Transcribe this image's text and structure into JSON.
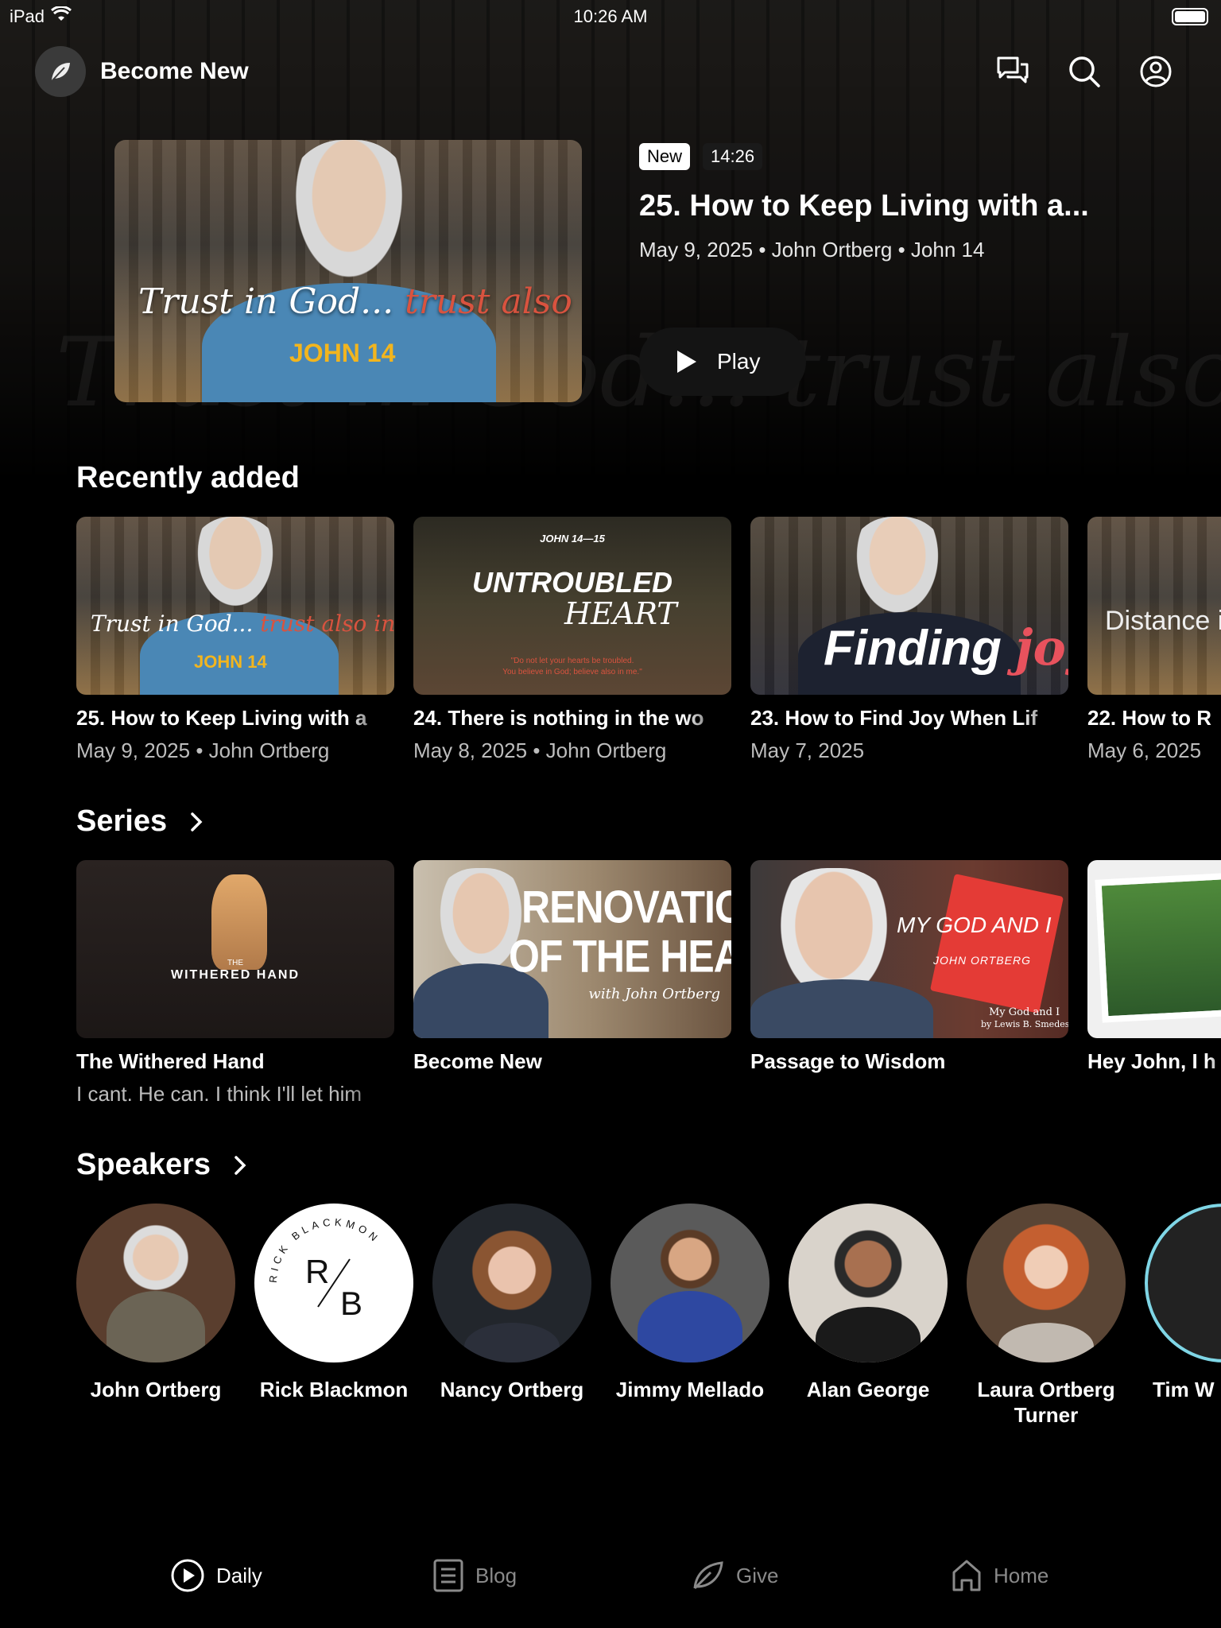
{
  "status_bar": {
    "device": "iPad",
    "time": "10:26 AM"
  },
  "header": {
    "app_title": "Become New",
    "icons": [
      "messages-icon",
      "search-icon",
      "profile-icon"
    ]
  },
  "featured": {
    "badge_new": "New",
    "duration": "14:26",
    "title": "25. How to Keep Living with a...",
    "meta": "May 9, 2025 • John Ortberg • John 14",
    "play_label": "Play",
    "thumb_line1_a": "Trust in God...",
    "thumb_line1_b": "trust also in me",
    "thumb_line2": "JOHN 14",
    "bg_text": "Trust in God... trust also in me"
  },
  "recently_added": {
    "title": "Recently added",
    "items": [
      {
        "title": "25. How to Keep Living with a",
        "meta": "May 9, 2025 • John Ortberg",
        "art_a": "Trust in God...",
        "art_b": "trust also in me",
        "art_c": "JOHN 14"
      },
      {
        "title": "24. There is nothing in the wo",
        "meta": "May 8, 2025 • John Ortberg",
        "art_a": "JOHN 14—15",
        "art_b": "UNTROUBLED",
        "art_c": "HEART",
        "art_d": "\"Do not let your hearts be troubled.",
        "art_e": "You believe in God; believe also in me.\""
      },
      {
        "title": "23. How to Find Joy When Lif",
        "meta": "May 7, 2025",
        "art_a": "Finding",
        "art_b": "joy"
      },
      {
        "title": "22. How to R",
        "meta": "May 6, 2025",
        "art_a": "Distance is"
      }
    ]
  },
  "series": {
    "title": "Series",
    "items": [
      {
        "title": "The Withered Hand",
        "subtitle": "I cant. He can. I think I'll let him",
        "art_a": "THE",
        "art_b": "WITHERED HAND"
      },
      {
        "title": "Become New",
        "subtitle": "",
        "art_a": "RENOVATION",
        "art_b": "OF THE HEART",
        "art_c": "with John Ortberg"
      },
      {
        "title": "Passage to Wisdom",
        "subtitle": "",
        "art_a": "MY GOD AND I",
        "art_b": "JOHN ORTBERG",
        "art_c": "My God and I",
        "art_d": "by Lewis B. Smedes"
      },
      {
        "title": "Hey John, I h",
        "subtitle": ""
      }
    ]
  },
  "speakers": {
    "title": "Speakers",
    "items": [
      {
        "name": "John Ortberg"
      },
      {
        "name": "Rick Blackmon",
        "logo_a": "R",
        "logo_b": "B",
        "logo_ring": "RICK BLACKMON"
      },
      {
        "name": "Nancy Ortberg"
      },
      {
        "name": "Jimmy Mellado"
      },
      {
        "name": "Alan George"
      },
      {
        "name": "Laura Ortberg Turner"
      },
      {
        "name": "Tim W"
      }
    ]
  },
  "bottom_nav": [
    {
      "label": "Daily",
      "icon": "play-circle-icon",
      "active": true
    },
    {
      "label": "Blog",
      "icon": "blog-icon",
      "active": false
    },
    {
      "label": "Give",
      "icon": "leaf-icon",
      "active": false
    },
    {
      "label": "Home",
      "icon": "home-icon",
      "active": false
    }
  ],
  "colors": {
    "accent_red": "#d9533f",
    "accent_gold": "#f2b51e",
    "background": "#000000"
  }
}
